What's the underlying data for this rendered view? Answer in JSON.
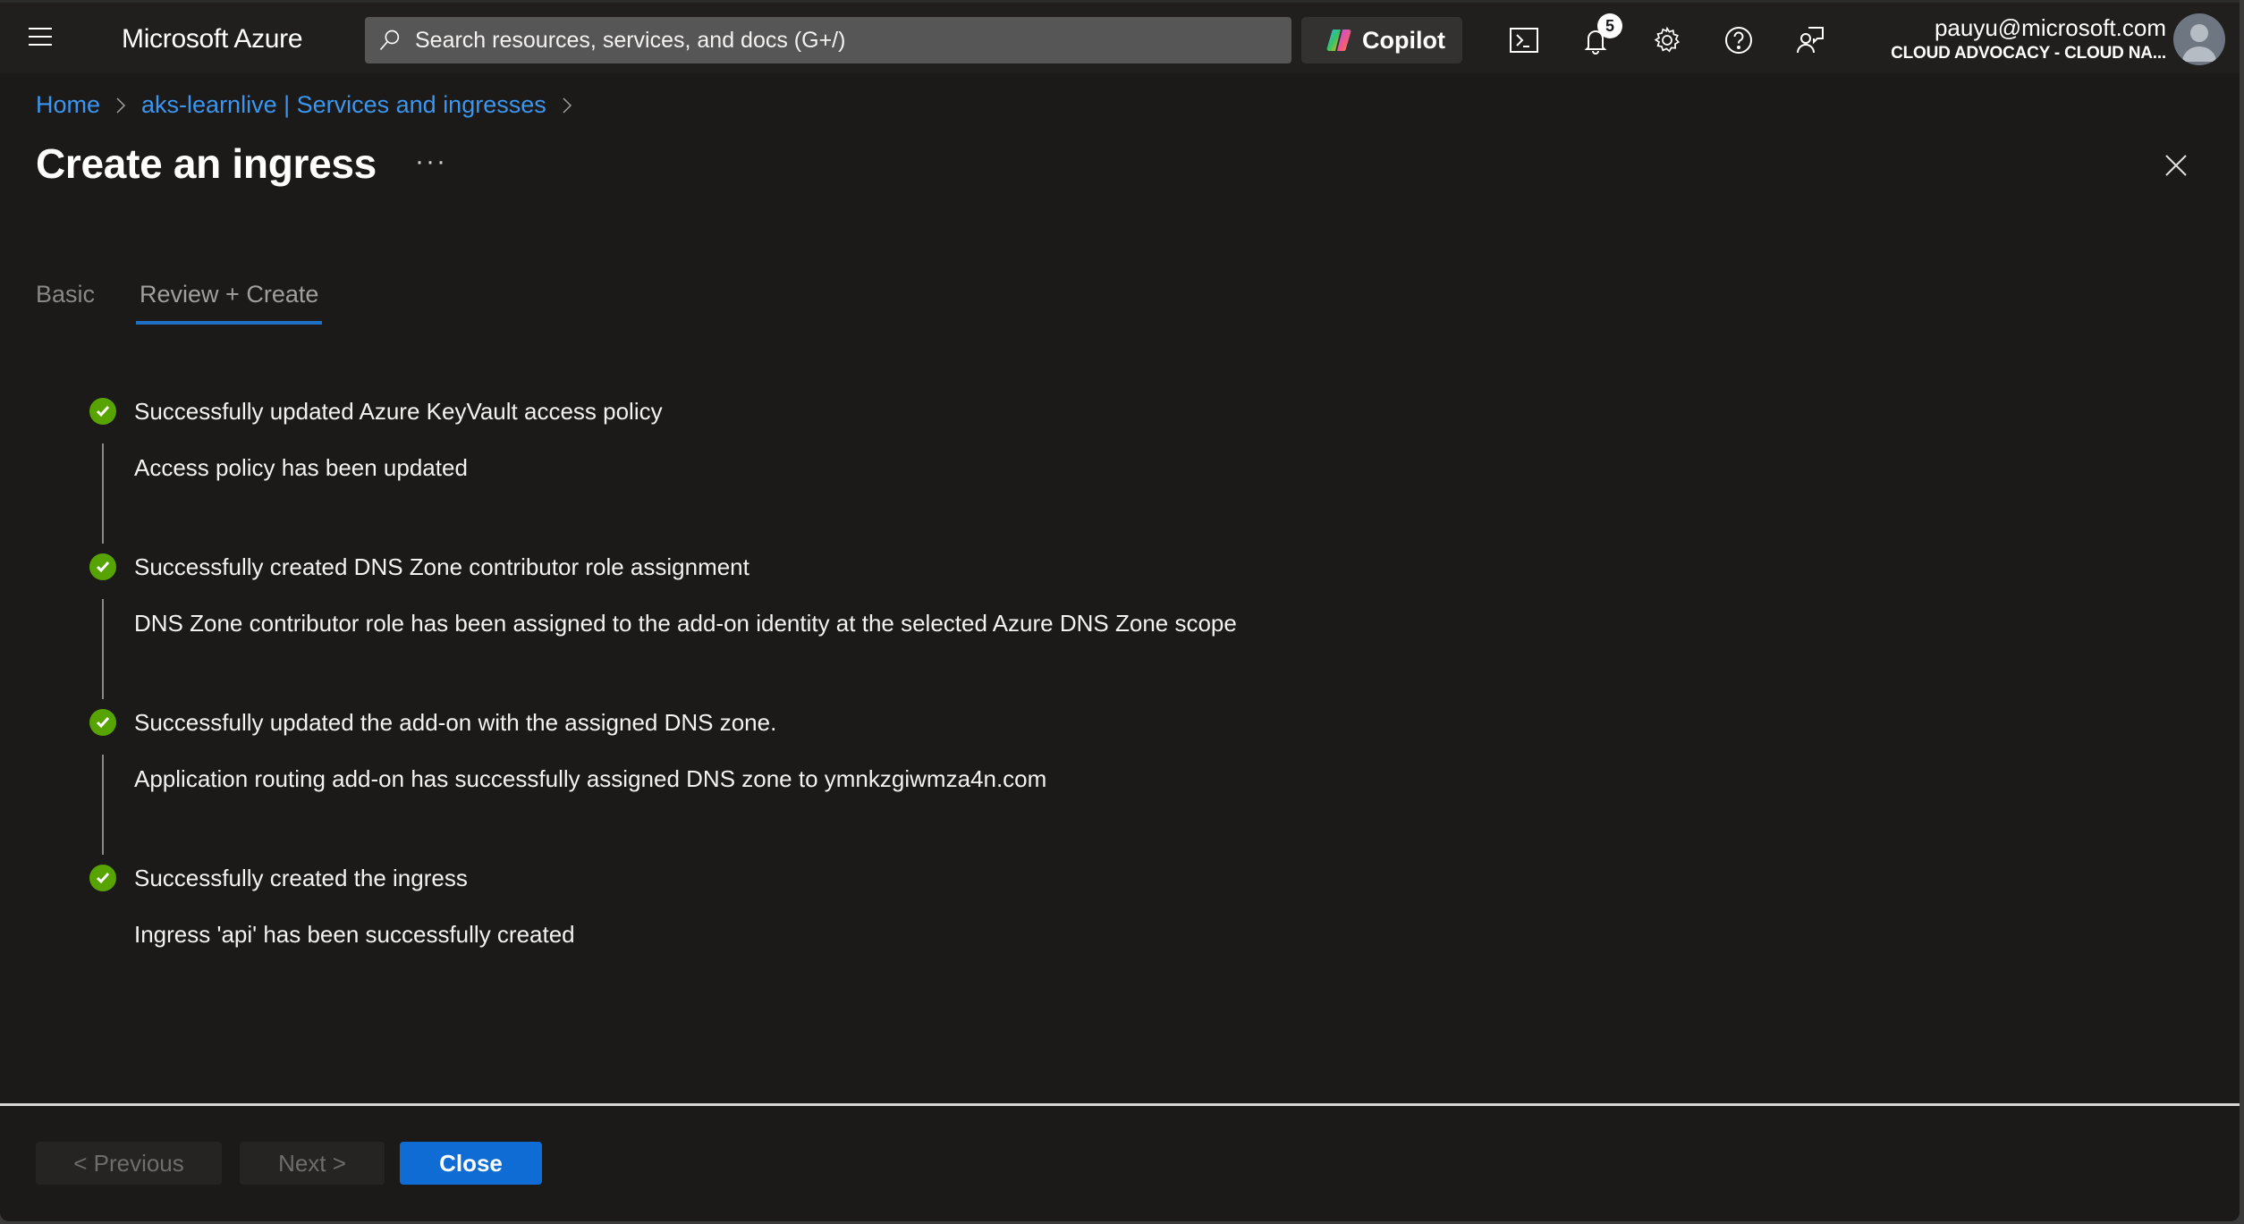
{
  "topbar": {
    "brand": "Microsoft Azure",
    "search_placeholder": "Search resources, services, and docs (G+/)",
    "copilot_label": "Copilot",
    "notifications_count": "5",
    "account_email": "pauyu@microsoft.com",
    "account_org": "CLOUD ADVOCACY - CLOUD NA..."
  },
  "breadcrumb": [
    {
      "label": "Home"
    },
    {
      "label": "aks-learnlive | Services and ingresses"
    }
  ],
  "page": {
    "title": "Create an ingress",
    "more_label": "···"
  },
  "tabs": [
    {
      "label": "Basic",
      "active": false
    },
    {
      "label": "Review + Create",
      "active": true
    }
  ],
  "steps": [
    {
      "status": "success",
      "title": "Successfully updated Azure KeyVault access policy",
      "description": "Access policy has been updated"
    },
    {
      "status": "success",
      "title": "Successfully created DNS Zone contributor role assignment",
      "description": "DNS Zone contributor role has been assigned to the add-on identity at the selected Azure DNS Zone scope"
    },
    {
      "status": "success",
      "title": "Successfully updated the add-on with the assigned DNS zone.",
      "description": "Application routing add-on has successfully assigned DNS zone to ymnkzgiwmza4n.com"
    },
    {
      "status": "success",
      "title": "Successfully created the ingress",
      "description": "Ingress 'api' has been successfully created"
    }
  ],
  "footer": {
    "previous_label": "< Previous",
    "next_label": "Next >",
    "close_label": "Close"
  },
  "colors": {
    "accent": "#0f6cd4",
    "link": "#3a96f0",
    "success": "#57a300",
    "background": "#1b1a19"
  }
}
